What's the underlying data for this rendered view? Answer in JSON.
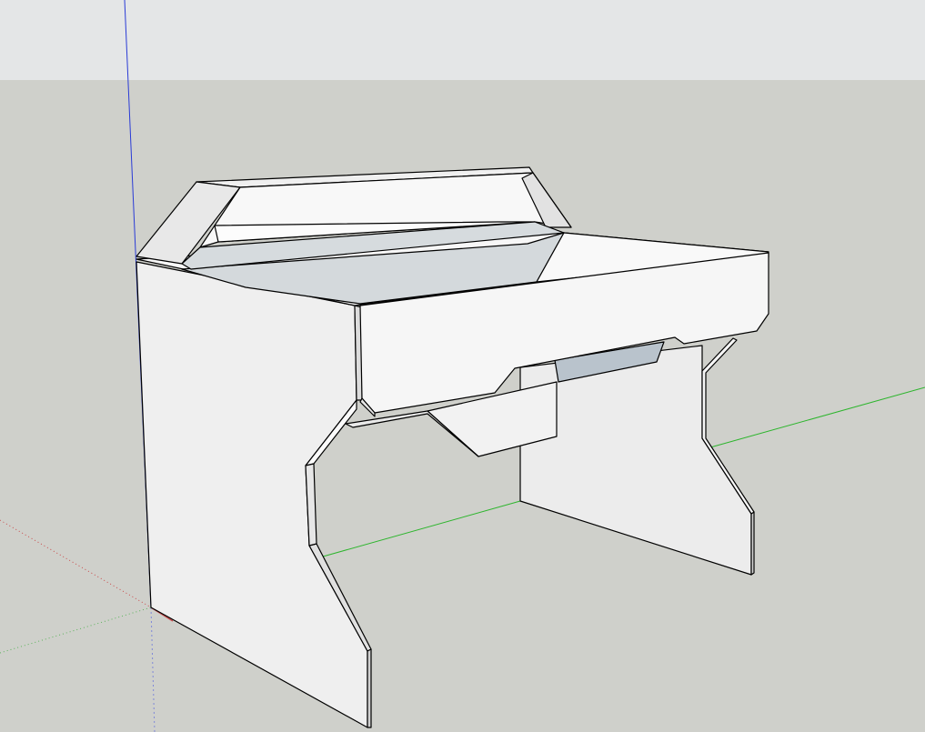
{
  "viewport": {
    "sky_color": "#e3e5e6",
    "ground_color": "#cfd0cb",
    "face_light": "#f4f4f4",
    "face_mid": "#ebebeb",
    "face_shade": "#d9dcdc",
    "face_blue": "#b9c3cc",
    "edge_color": "#000000",
    "axis_red": "#c94c4c",
    "axis_green": "#2db52d",
    "axis_blue": "#2a3bd6"
  },
  "model": {
    "object": "desk"
  }
}
